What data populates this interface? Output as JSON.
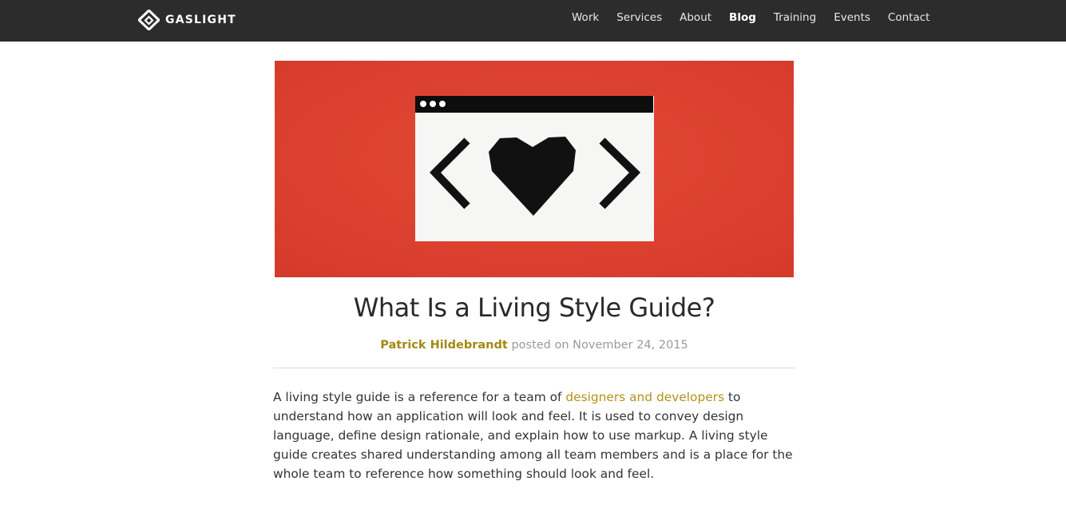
{
  "header": {
    "brand": "GASLIGHT",
    "nav": [
      {
        "label": "Work",
        "active": false
      },
      {
        "label": "Services",
        "active": false
      },
      {
        "label": "About",
        "active": false
      },
      {
        "label": "Blog",
        "active": true
      },
      {
        "label": "Training",
        "active": false
      },
      {
        "label": "Events",
        "active": false
      },
      {
        "label": "Contact",
        "active": false
      }
    ]
  },
  "hero": {
    "icons": [
      "browser-window-icon",
      "chevron-left-icon",
      "heart-icon",
      "chevron-right-icon"
    ],
    "background_color": "#de3f2e"
  },
  "post": {
    "title": "What Is a Living Style Guide?",
    "author": "Patrick Hildebrandt",
    "posted_on_text": "posted on November 24, 2015",
    "intro": {
      "before_link": "A living style guide is a reference for a team of ",
      "link_text": "designers and developers",
      "after_link": " to understand how an application will look and feel. It is used to convey design language, define design rationale, and explain how to use markup. A living style guide creates shared understanding among all team members and is a place for the whole team to reference how something should look and feel."
    }
  },
  "colors": {
    "topbar": "#2c2c2c",
    "accent": "#a48913",
    "hero_red": "#de3f2e"
  }
}
